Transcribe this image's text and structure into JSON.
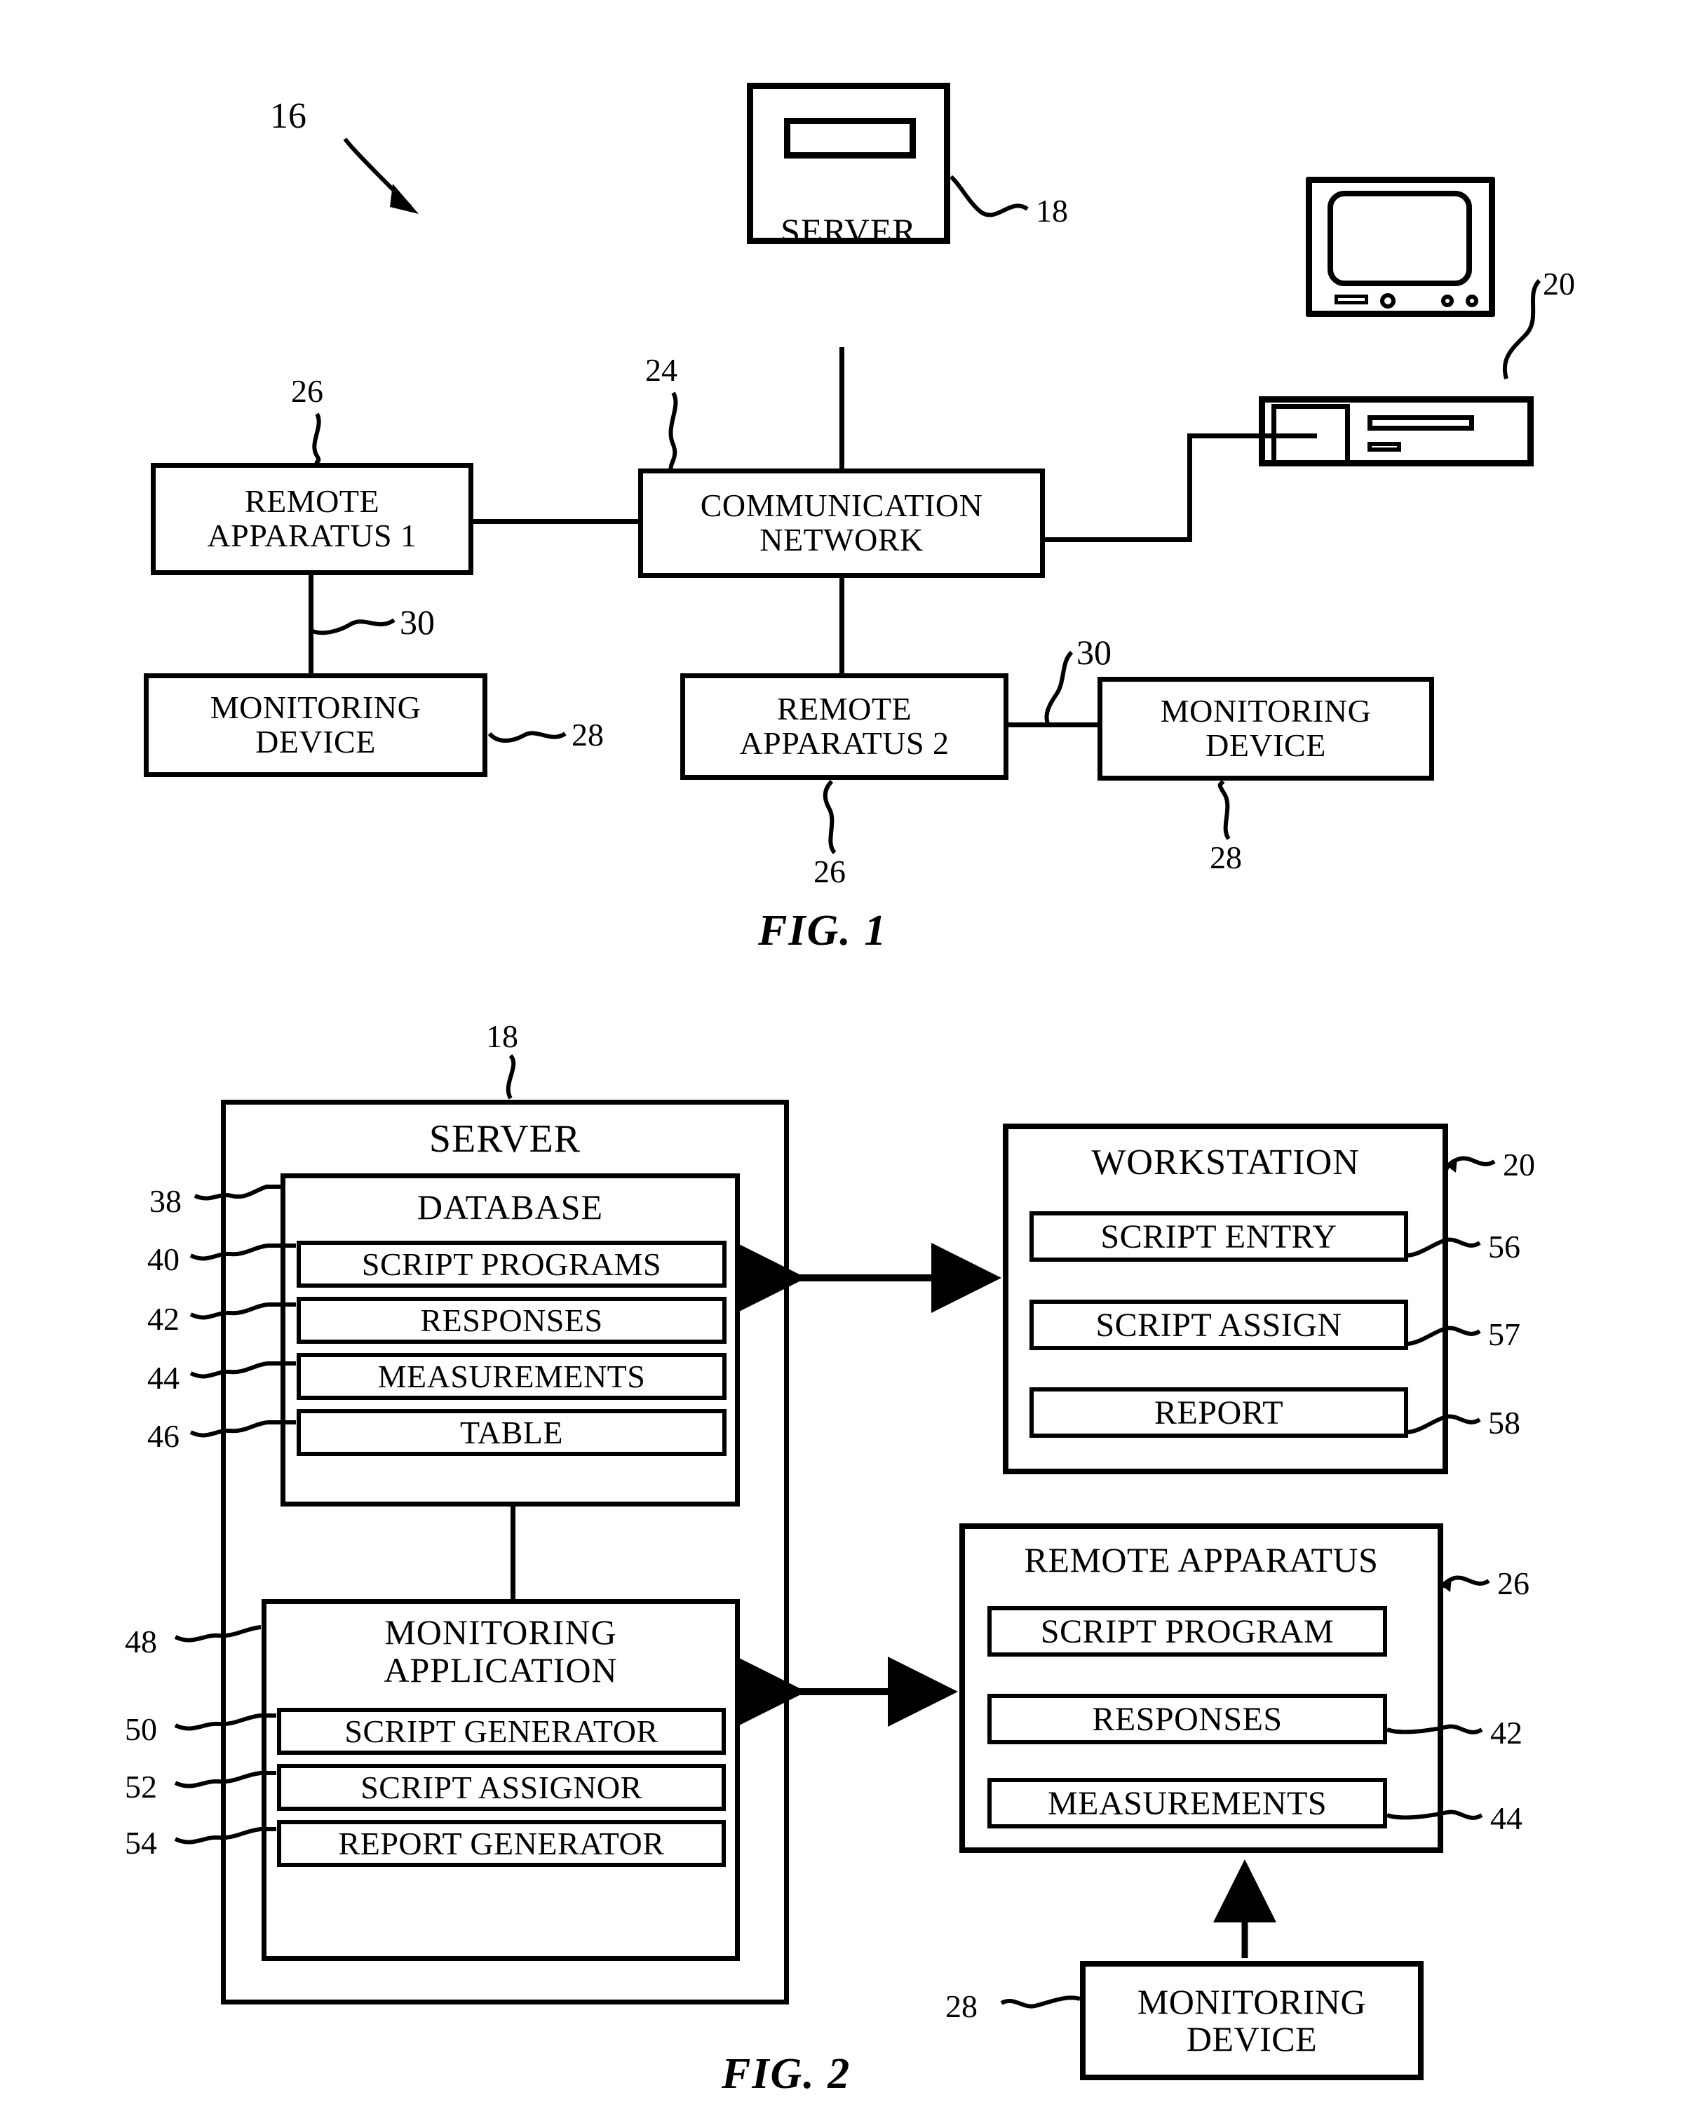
{
  "figures": [
    {
      "caption": "FIG. 1",
      "system_ref": "16",
      "nodes": {
        "server_icon": {
          "label": "SERVER",
          "ref": "18"
        },
        "workstation_icon": {
          "label": "",
          "ref": "20"
        },
        "communication_network": {
          "line1": "COMMUNICATION",
          "line2": "NETWORK",
          "ref": "24"
        },
        "remote_apparatus_1": {
          "line1": "REMOTE",
          "line2": "APPARATUS 1",
          "ref": "26"
        },
        "remote_apparatus_2": {
          "line1": "REMOTE",
          "line2": "APPARATUS 2",
          "ref": "26"
        },
        "monitoring_device_left": {
          "line1": "MONITORING",
          "line2": "DEVICE",
          "ref": "28"
        },
        "monitoring_device_right": {
          "line1": "MONITORING",
          "line2": "DEVICE",
          "ref": "28"
        }
      },
      "link_refs": {
        "left_link": "30",
        "right_link": "30"
      }
    },
    {
      "caption": "FIG. 2",
      "server": {
        "title": "SERVER",
        "ref": "18",
        "database": {
          "title": "DATABASE",
          "ref": "38",
          "items": [
            {
              "label": "SCRIPT PROGRAMS",
              "ref": "40"
            },
            {
              "label": "RESPONSES",
              "ref": "42"
            },
            {
              "label": "MEASUREMENTS",
              "ref": "44"
            },
            {
              "label": "TABLE",
              "ref": "46"
            }
          ]
        },
        "monitoring_application": {
          "line1": "MONITORING",
          "line2": "APPLICATION",
          "ref": "48",
          "items": [
            {
              "label": "SCRIPT GENERATOR",
              "ref": "50"
            },
            {
              "label": "SCRIPT ASSIGNOR",
              "ref": "52"
            },
            {
              "label": "REPORT GENERATOR",
              "ref": "54"
            }
          ]
        }
      },
      "workstation": {
        "title": "WORKSTATION",
        "ref": "20",
        "items": [
          {
            "label": "SCRIPT ENTRY",
            "ref": "56"
          },
          {
            "label": "SCRIPT ASSIGN",
            "ref": "57"
          },
          {
            "label": "REPORT",
            "ref": "58"
          }
        ]
      },
      "remote_apparatus": {
        "title": "REMOTE APPARATUS",
        "ref": "26",
        "items": [
          {
            "label": "SCRIPT PROGRAM",
            "ref": ""
          },
          {
            "label": "RESPONSES",
            "ref": "42"
          },
          {
            "label": "MEASUREMENTS",
            "ref": "44"
          }
        ]
      },
      "monitoring_device": {
        "line1": "MONITORING",
        "line2": "DEVICE",
        "ref": "28"
      }
    }
  ]
}
